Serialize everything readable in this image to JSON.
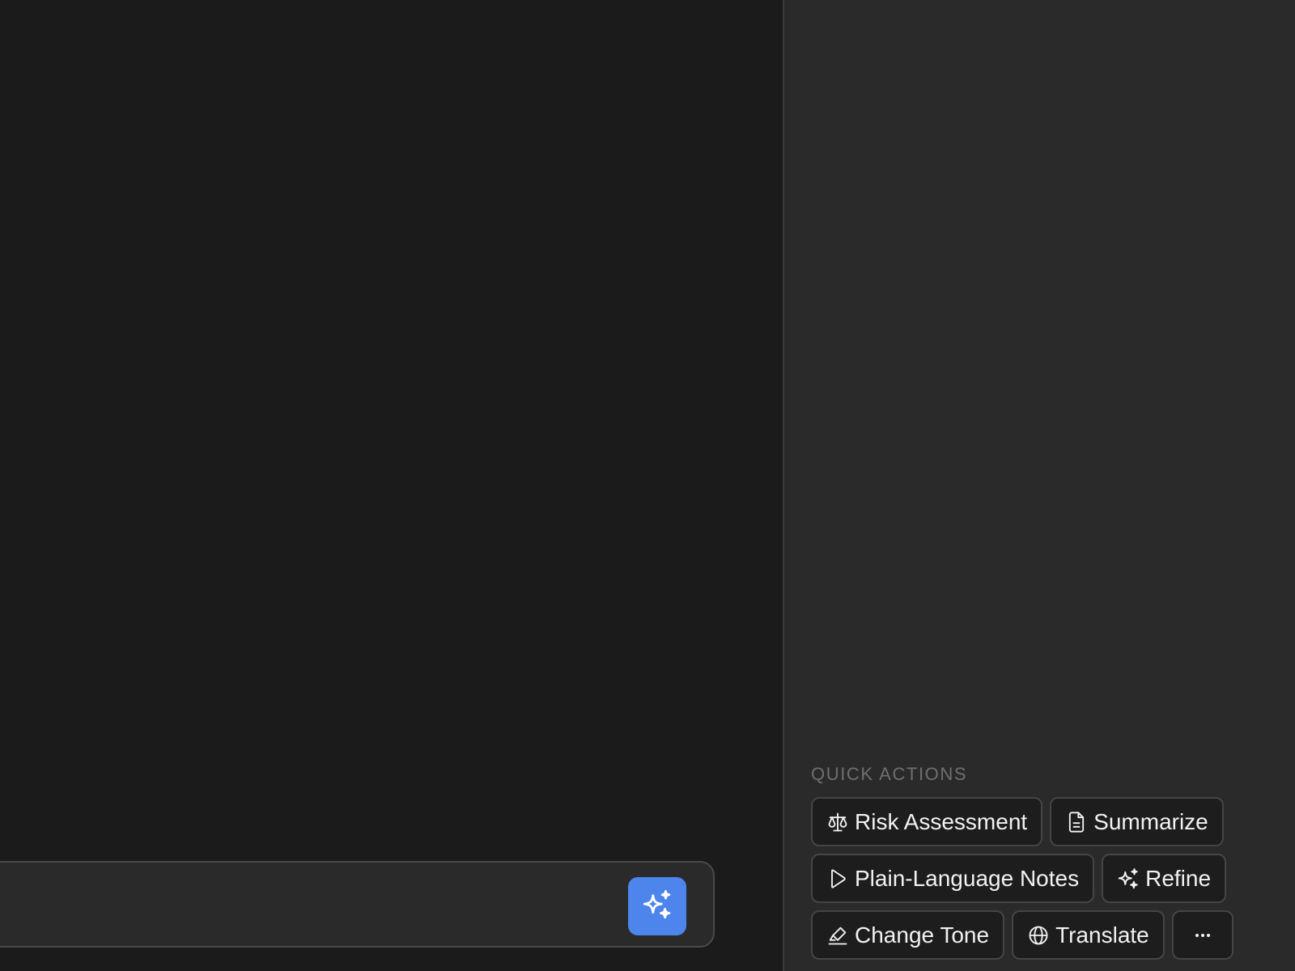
{
  "composer": {
    "placeholder": ""
  },
  "quick_actions": {
    "heading": "QUICK ACTIONS",
    "rows": [
      [
        {
          "label": "Risk Assessment",
          "icon": "scale-icon"
        },
        {
          "label": "Summarize",
          "icon": "document-icon"
        }
      ],
      [
        {
          "label": "Plain-Language Notes",
          "icon": "play-icon"
        },
        {
          "label": "Refine",
          "icon": "sparkle-icon"
        }
      ],
      [
        {
          "label": "Change Tone",
          "icon": "highlighter-icon"
        },
        {
          "label": "Translate",
          "icon": "globe-icon"
        },
        {
          "label": "",
          "icon": "more-icon"
        }
      ]
    ]
  },
  "colors": {
    "accent": "#4d85ec",
    "main_bg": "#1b1b1b",
    "sidebar_bg": "#2a2a2a",
    "chip_bg": "#1d1d1d",
    "chip_border": "#454545",
    "heading": "#6f6f6f"
  }
}
